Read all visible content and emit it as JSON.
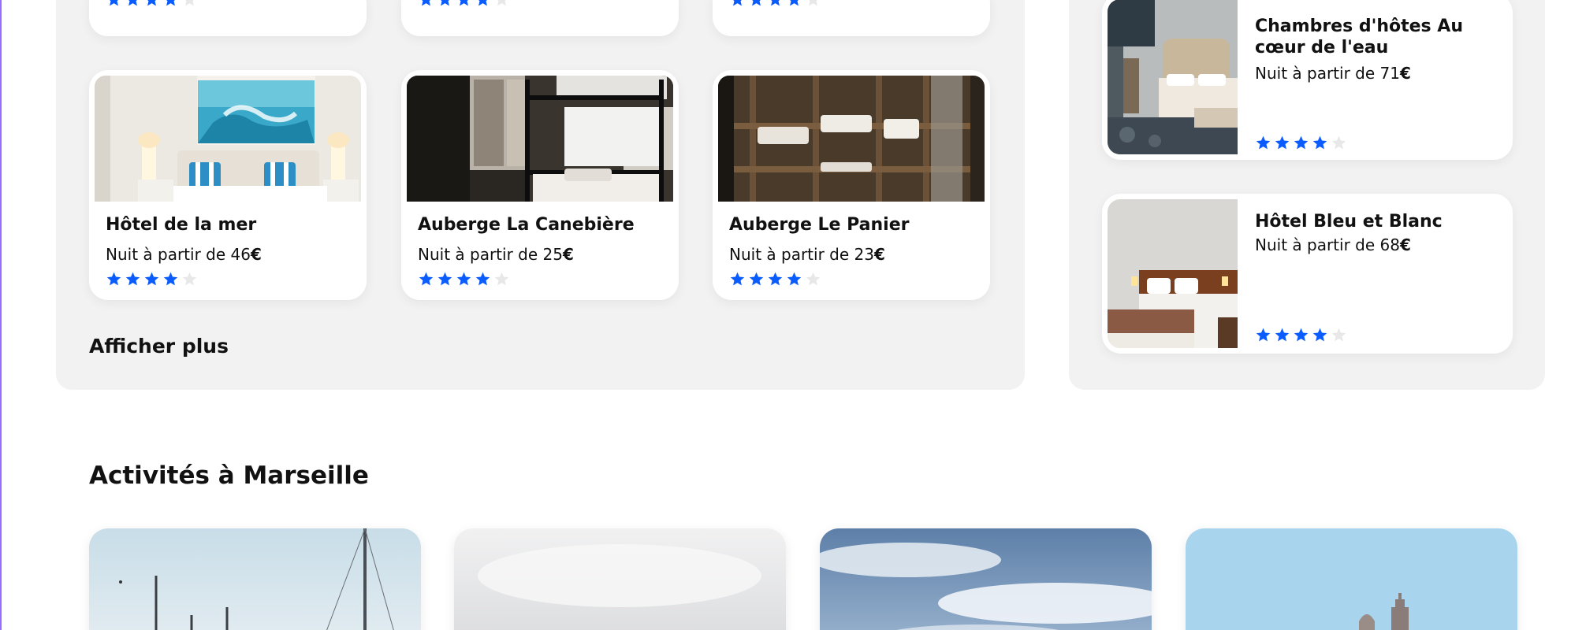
{
  "colors": {
    "star_filled": "#0a5cff",
    "star_empty": "#e8e8e8",
    "panel": "#f2f2f2"
  },
  "top_row_stub_cards": [
    {
      "rating": 4
    },
    {
      "rating": 4
    },
    {
      "rating": 4
    }
  ],
  "hotels": [
    {
      "name": "Hôtel de la mer",
      "price_prefix": "Nuit à partir de 46",
      "currency": "€",
      "rating": 4,
      "photo": "bedroom-with-sea-painting"
    },
    {
      "name": "Auberge La Canebière",
      "price_prefix": "Nuit à partir de 25",
      "currency": "€",
      "rating": 4,
      "photo": "hostel-bunk-beds-window"
    },
    {
      "name": "Auberge Le Panier",
      "price_prefix": "Nuit à partir de 23",
      "currency": "€",
      "rating": 4,
      "photo": "wooden-capsule-bunks"
    }
  ],
  "show_more_label": "Afficher plus",
  "sidebar_hotels": [
    {
      "name": "Chambres d'hôtes Au cœur de l'eau",
      "price_prefix": "Nuit à partir de 71",
      "currency": "€",
      "rating": 4,
      "photo": "upholstered-bed-room"
    },
    {
      "name": "Hôtel Bleu et Blanc",
      "price_prefix": "Nuit à partir de 68",
      "currency": "€",
      "rating": 4,
      "photo": "hotel-room-wood-headboard"
    }
  ],
  "activities_section": {
    "title": "Activités à Marseille",
    "cards": [
      {
        "photo": "harbour-sailboats"
      },
      {
        "photo": "cloudy-sky"
      },
      {
        "photo": "blue-sky-clouds"
      },
      {
        "photo": "notre-dame-de-la-garde"
      }
    ]
  }
}
